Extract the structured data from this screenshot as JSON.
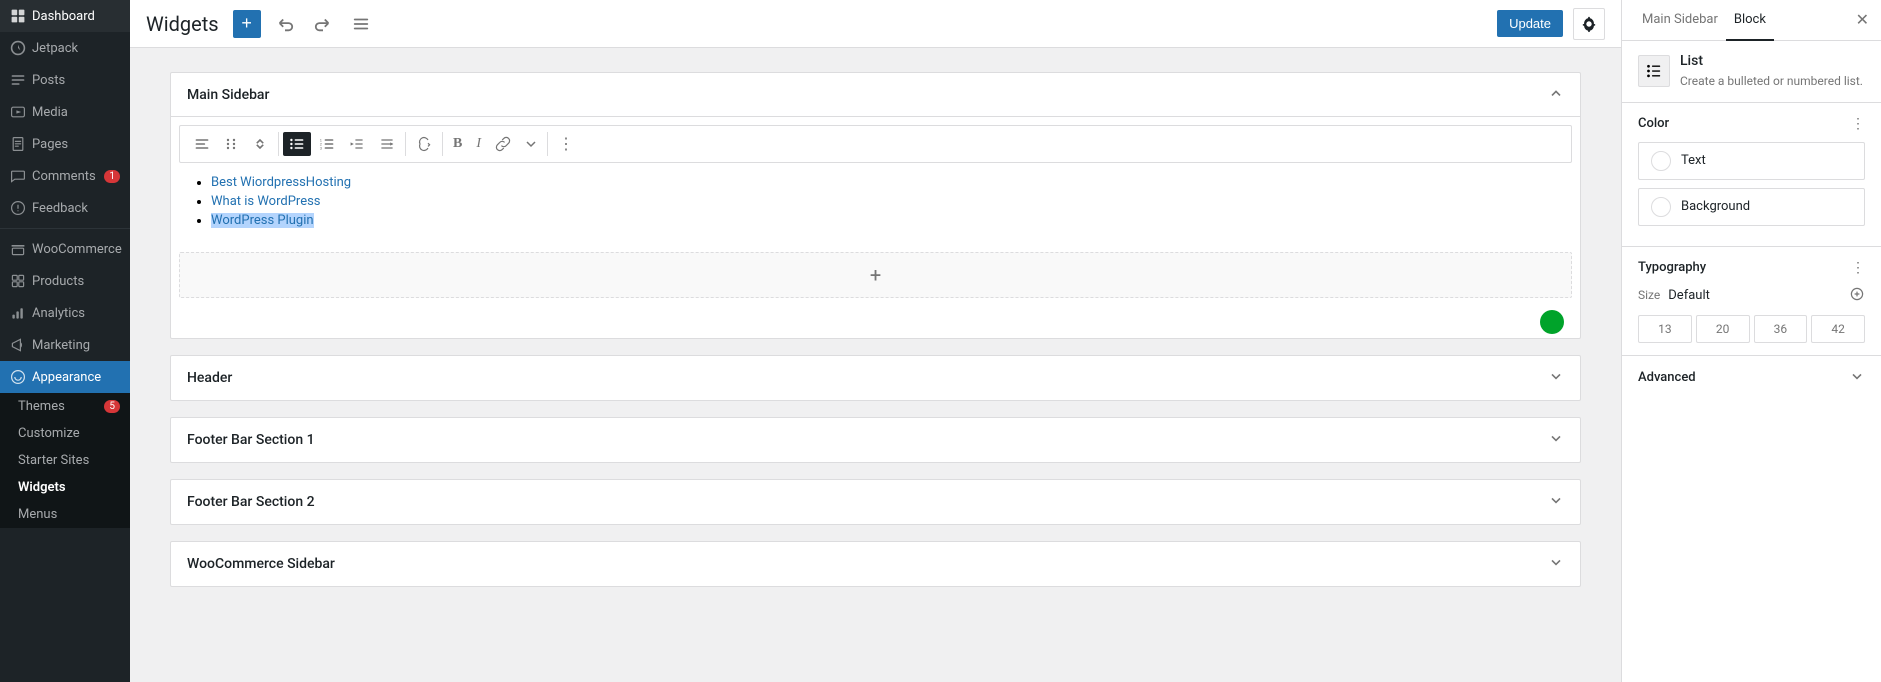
{
  "sidebar": {
    "items": [
      {
        "id": "dashboard",
        "label": "Dashboard",
        "icon": "dashboard"
      },
      {
        "id": "jetpack",
        "label": "Jetpack",
        "icon": "jetpack"
      },
      {
        "id": "posts",
        "label": "Posts",
        "icon": "posts"
      },
      {
        "id": "media",
        "label": "Media",
        "icon": "media"
      },
      {
        "id": "pages",
        "label": "Pages",
        "icon": "pages"
      },
      {
        "id": "comments",
        "label": "Comments",
        "icon": "comments",
        "badge": "1"
      },
      {
        "id": "feedback",
        "label": "Feedback",
        "icon": "feedback"
      },
      {
        "id": "woocommerce",
        "label": "WooCommerce",
        "icon": "woocommerce"
      },
      {
        "id": "products",
        "label": "Products",
        "icon": "products"
      },
      {
        "id": "analytics",
        "label": "Analytics",
        "icon": "analytics"
      },
      {
        "id": "marketing",
        "label": "Marketing",
        "icon": "marketing"
      },
      {
        "id": "appearance",
        "label": "Appearance",
        "icon": "appearance",
        "active": true
      }
    ],
    "submenu": {
      "parent": "appearance",
      "items": [
        {
          "id": "themes",
          "label": "Themes",
          "badge": "5"
        },
        {
          "id": "customize",
          "label": "Customize"
        },
        {
          "id": "starter-sites",
          "label": "Starter Sites"
        },
        {
          "id": "widgets",
          "label": "Widgets",
          "active": true
        },
        {
          "id": "menus",
          "label": "Menus"
        }
      ]
    }
  },
  "topbar": {
    "title": "Widgets",
    "add_label": "+",
    "undo_label": "↩",
    "redo_label": "↪",
    "list_view_label": "≡",
    "update_label": "Update",
    "settings_label": "⚙"
  },
  "right_panel": {
    "tab_main_sidebar": "Main Sidebar",
    "tab_block": "Block",
    "close_label": "✕",
    "block_title": "List",
    "block_description": "Create a bulleted or numbered list.",
    "color_section_title": "Color",
    "color_options": [
      {
        "id": "text",
        "label": "Text"
      },
      {
        "id": "background",
        "label": "Background"
      }
    ],
    "typography_title": "Typography",
    "size_label": "Size",
    "size_default": "Default",
    "size_values": [
      "13",
      "20",
      "36",
      "42"
    ],
    "advanced_title": "Advanced"
  },
  "main_sidebar": {
    "title": "Main Sidebar",
    "list_items": [
      {
        "text": "Best WiordpressHosting",
        "href": "#"
      },
      {
        "text": "What is WordPress",
        "href": "#"
      },
      {
        "text": "WordPress Plugin",
        "href": "#",
        "selected": true
      }
    ]
  },
  "widget_areas": [
    {
      "id": "header",
      "title": "Header",
      "open": false
    },
    {
      "id": "footer-bar-1",
      "title": "Footer Bar Section 1",
      "open": false
    },
    {
      "id": "footer-bar-2",
      "title": "Footer Bar Section 2",
      "open": false
    },
    {
      "id": "woocommerce-sidebar",
      "title": "WooCommerce Sidebar",
      "open": false
    }
  ],
  "toolbar": {
    "buttons": [
      {
        "id": "align",
        "label": "≡",
        "tooltip": "Align"
      },
      {
        "id": "drag",
        "label": "⠿",
        "tooltip": "Drag"
      },
      {
        "id": "move",
        "label": "⌃⌄",
        "tooltip": "Move"
      },
      {
        "id": "list",
        "label": "☰",
        "tooltip": "List",
        "active": true
      },
      {
        "id": "ordered",
        "label": "≔",
        "tooltip": "Ordered List"
      },
      {
        "id": "indent-out",
        "label": "⇤",
        "tooltip": "Outdent"
      },
      {
        "id": "indent-in",
        "label": "⇥",
        "tooltip": "Indent"
      },
      {
        "id": "transform",
        "label": "↻",
        "tooltip": "Transform"
      },
      {
        "id": "bold",
        "label": "B",
        "tooltip": "Bold"
      },
      {
        "id": "italic",
        "label": "I",
        "tooltip": "Italic"
      },
      {
        "id": "link",
        "label": "🔗",
        "tooltip": "Link"
      },
      {
        "id": "more",
        "label": "▾",
        "tooltip": "More"
      },
      {
        "id": "options",
        "label": "⋮",
        "tooltip": "Options"
      }
    ]
  },
  "colors": {
    "brand_blue": "#2271b1",
    "sidebar_bg": "#1d2327",
    "active_bg": "#2271b1",
    "submenu_bg": "#101517"
  }
}
